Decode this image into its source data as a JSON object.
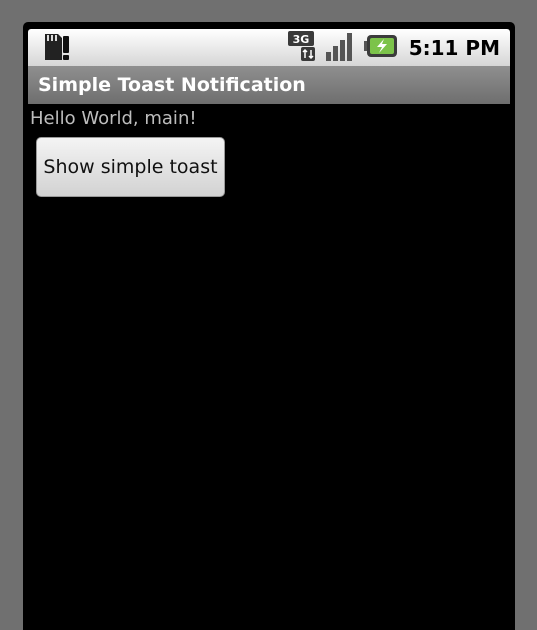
{
  "status_bar": {
    "time": "5:11 PM",
    "network_type": "3G",
    "icons": [
      "sd-card-alert-icon",
      "3g-data-icon",
      "signal-strength-icon",
      "battery-charging-icon"
    ],
    "battery_color": "#7cc34a"
  },
  "app": {
    "title": "Simple Toast Notification"
  },
  "main": {
    "text": "Hello World, main!",
    "button_label": "Show simple toast"
  }
}
